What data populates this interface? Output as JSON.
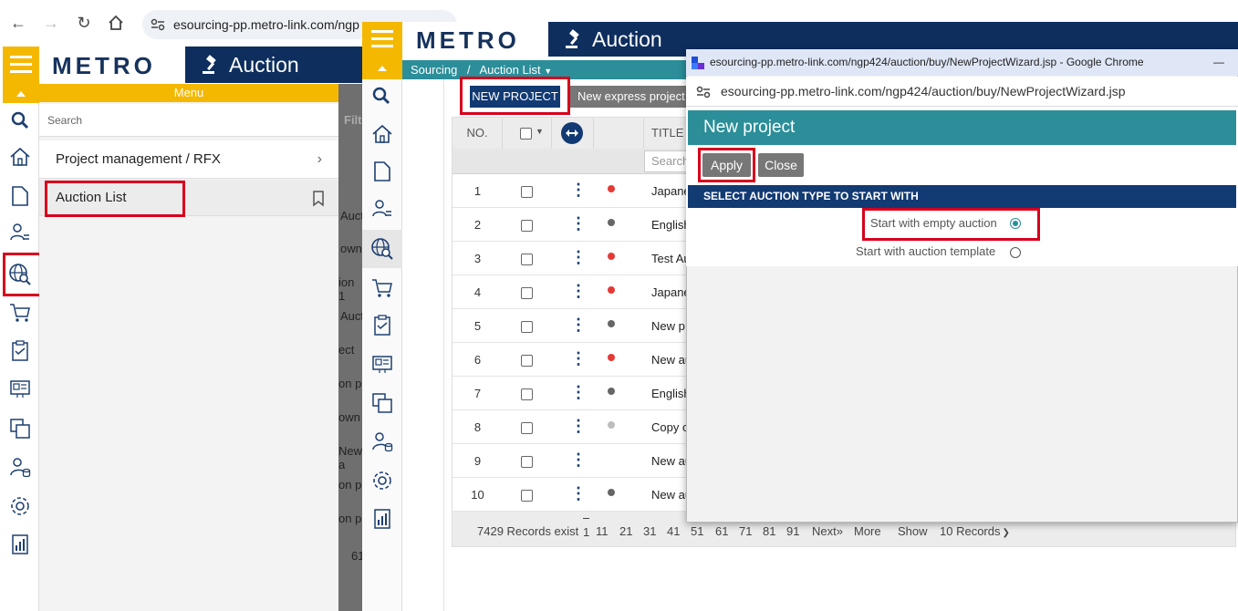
{
  "back_browser": {
    "url": "esourcing-pp.metro-link.com/ngp",
    "logo": "METRO",
    "app_title": "Auction",
    "menu": {
      "title": "Menu",
      "search_placeholder": "Search",
      "items": [
        {
          "label": "Project management / RFX"
        },
        {
          "label": "Auction List"
        }
      ]
    },
    "background_fragments": [
      "Filt",
      "Auct",
      "own",
      "ion 1",
      "Auct",
      "ect",
      "on p",
      "own",
      "New a",
      "on p",
      "on p",
      "61"
    ]
  },
  "main_window": {
    "logo": "METRO",
    "app_title": "Auction",
    "breadcrumb": {
      "root": "Sourcing",
      "separator": "/",
      "current": "Auction List"
    },
    "toolbar": {
      "new_project": "NEW PROJECT",
      "new_express": "New express project"
    },
    "grid": {
      "headers": {
        "no": "NO.",
        "title": "TITLE"
      },
      "title_search_placeholder": "Search",
      "rows": [
        {
          "no": "1",
          "status_color": "#e53935",
          "title": "Japane"
        },
        {
          "no": "2",
          "status_color": "#666666",
          "title": "English"
        },
        {
          "no": "3",
          "status_color": "#e53935",
          "title": "Test Au"
        },
        {
          "no": "4",
          "status_color": "#e53935",
          "title": "Japane"
        },
        {
          "no": "5",
          "status_color": "#666666",
          "title": "New p"
        },
        {
          "no": "6",
          "status_color": "#e53935",
          "title": "New au"
        },
        {
          "no": "7",
          "status_color": "#666666",
          "title": "English"
        },
        {
          "no": "8",
          "status_color": "#bdbdbd",
          "title": "Copy o"
        },
        {
          "no": "9",
          "status_color": "",
          "title": "New au"
        },
        {
          "no": "10",
          "status_color": "#666666",
          "title": "New au"
        }
      ]
    },
    "pager": {
      "records_text": "7429 Records exist",
      "pages": [
        "1",
        "11",
        "21",
        "31",
        "41",
        "51",
        "61",
        "71",
        "81",
        "91"
      ],
      "next": "Next»",
      "more": "More",
      "show": "Show",
      "per_page": "10 Records"
    }
  },
  "popup": {
    "window_title": "esourcing-pp.metro-link.com/ngp424/auction/buy/NewProjectWizard.jsp - Google Chrome",
    "url": "esourcing-pp.metro-link.com/ngp424/auction/buy/NewProjectWizard.jsp",
    "minimize": "—",
    "header": "New project",
    "apply": "Apply",
    "close": "Close",
    "section_title": "SELECT AUCTION TYPE TO START WITH",
    "option_empty": "Start with empty auction",
    "option_template": "Start with auction template",
    "selected_option": "Start with empty auction"
  },
  "colors": {
    "metro_navy": "#0e2e5e",
    "metro_yellow": "#f5b800",
    "teal": "#2b8e99",
    "highlight_red": "#d6001c"
  }
}
